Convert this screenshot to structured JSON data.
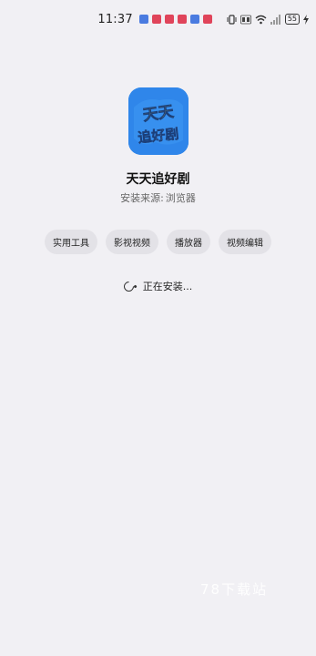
{
  "status_bar": {
    "time": "11:37",
    "notification_colors": [
      "#4a7be0",
      "#e0445a",
      "#e0445a",
      "#e0445a",
      "#4a7be0",
      "#e0445a"
    ],
    "battery_level": "55",
    "icons": [
      "vibrate-icon",
      "hd-icon",
      "wifi-icon",
      "signal-icon",
      "battery-icon",
      "charging-icon"
    ]
  },
  "app": {
    "icon_text_top": "天天",
    "icon_text_bottom": "追好剧",
    "name": "天天追好剧",
    "install_source_label": "安装来源:",
    "install_source_value": "浏览器",
    "accent_color": "#2f86ea"
  },
  "tags": [
    "实用工具",
    "影视视频",
    "播放器",
    "视频编辑"
  ],
  "installing": {
    "status_text": "正在安装..."
  },
  "watermark": "78下载站"
}
